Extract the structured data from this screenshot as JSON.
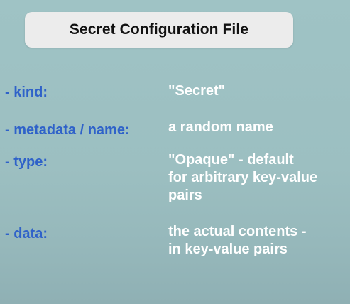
{
  "title": "Secret Configuration File",
  "rows": [
    {
      "key": "- kind:",
      "value_lines": [
        "\"Secret\""
      ]
    },
    {
      "key": "- metadata / name:",
      "value_lines": [
        "a random name"
      ]
    },
    {
      "key": "- type:",
      "value_lines": [
        "\"Opaque\" - default",
        "for arbitrary key-value",
        "pairs"
      ]
    },
    {
      "key": "- data:",
      "value_lines": [
        "the actual contents -",
        "in key-value pairs"
      ]
    }
  ],
  "colors": {
    "key_text": "#2f62c9",
    "value_text": "#ffffff",
    "title_box": "#ececec",
    "background": "#9fc3c5"
  }
}
